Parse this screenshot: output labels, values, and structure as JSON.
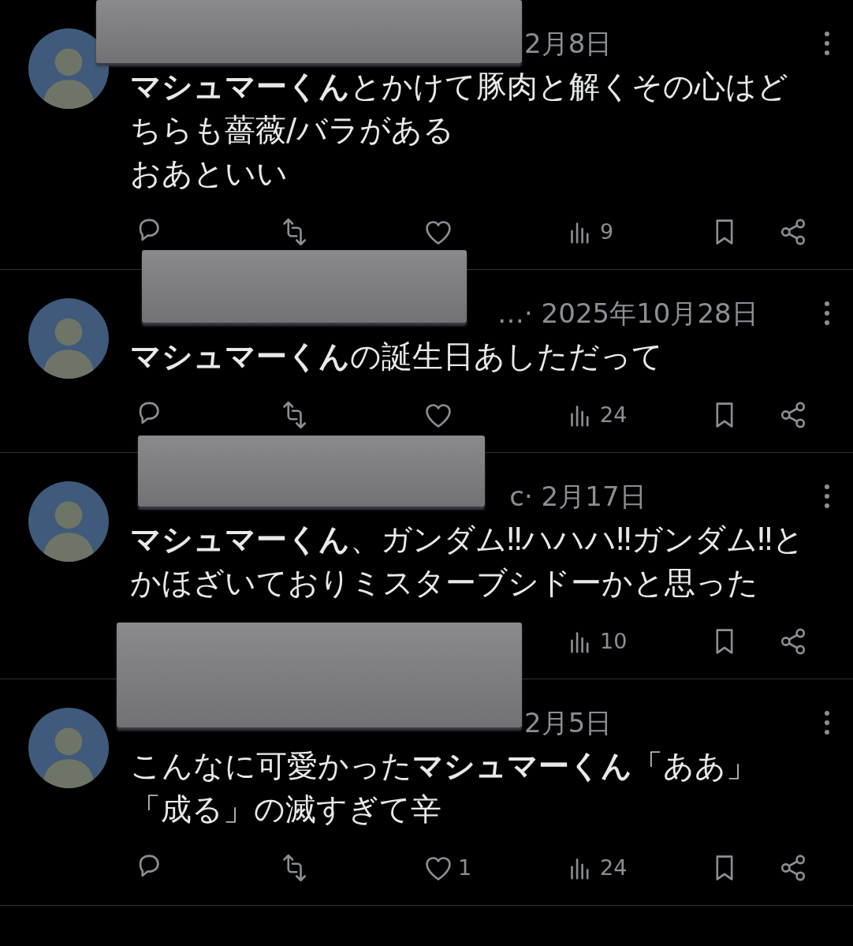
{
  "posts": [
    {
      "header": {
        "time": "2月8日"
      },
      "body": [
        "**マシュマーくん**とかけて豚肉と解くその心はどちらも薔薇/バラがある",
        "おあといい"
      ],
      "actions": [
        {
          "kind": "reply"
        },
        {
          "kind": "repost"
        },
        {
          "kind": "like"
        },
        {
          "kind": "views",
          "count": "9"
        },
        {
          "kind": "bookmark"
        },
        {
          "kind": "share"
        }
      ]
    },
    {
      "header": {
        "name_end": "…",
        "time": "· 2025年10月28日"
      },
      "body": [
        "**マシュマーくん**の誕生日あしただって"
      ],
      "actions": [
        {
          "kind": "reply"
        },
        {
          "kind": "repost"
        },
        {
          "kind": "like"
        },
        {
          "kind": "views",
          "count": "24"
        },
        {
          "kind": "bookmark"
        },
        {
          "kind": "share"
        }
      ]
    },
    {
      "header": {
        "name_end": "c",
        "time": "· 2月17日"
      },
      "body": [
        "**マシュマーくん**、ガンダム‼ハハハ‼ガンダム‼とかほざいておりミスターブシドーかと思った"
      ],
      "actions": [
        {
          "kind": "views",
          "count": "10"
        },
        {
          "kind": "bookmark"
        },
        {
          "kind": "share"
        }
      ]
    },
    {
      "header": {
        "time": "2月5日"
      },
      "body": [
        "こんなに可愛かった**マシュマーくん**「ああ」「成る」の滅すぎて辛"
      ],
      "actions": [
        {
          "kind": "reply"
        },
        {
          "kind": "repost"
        },
        {
          "kind": "like",
          "count": "1"
        },
        {
          "kind": "views",
          "count": "24"
        },
        {
          "kind": "bookmark"
        },
        {
          "kind": "share"
        }
      ]
    }
  ]
}
